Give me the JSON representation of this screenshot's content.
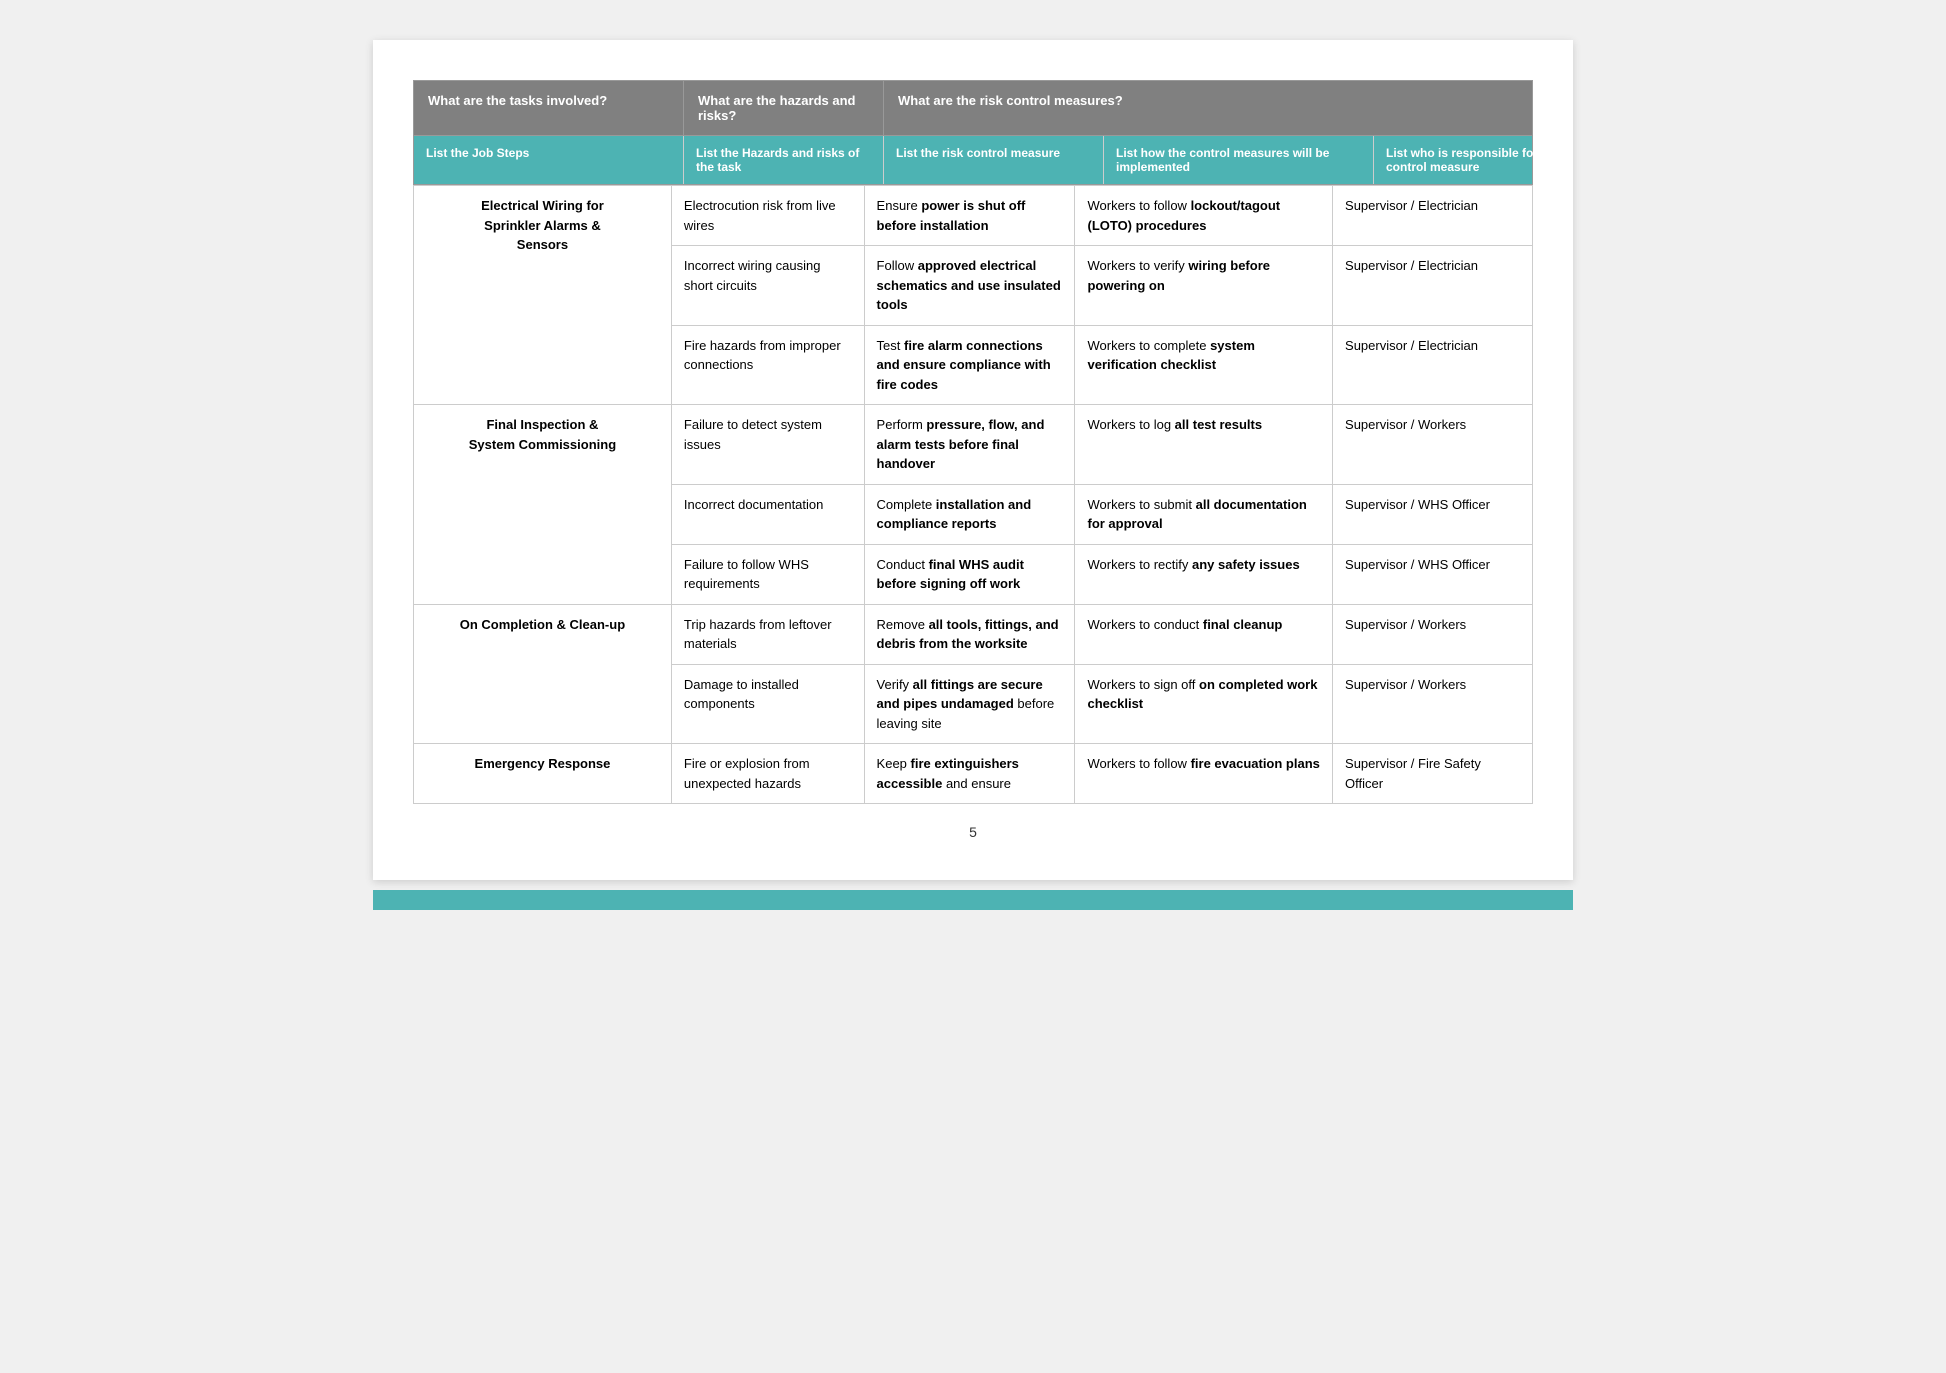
{
  "header": {
    "col1": "What are the tasks involved?",
    "col2": "What are the hazards and risks?",
    "col3": "What are the risk control measures?"
  },
  "subheader": {
    "col1": "List the Job Steps",
    "col2": "List the Hazards and risks of the task",
    "col3": "List the risk control measure",
    "col4": "List how the control measures will be implemented",
    "col5": "List who is responsible for the control measure"
  },
  "rows": [
    {
      "job_step": "Electrical Wiring for Sprinkler Alarms & Sensors",
      "hazard": "Electrocution risk from live wires",
      "control": "Ensure power is shut off before installation",
      "control_bold": [
        "power is shut",
        "off before installation"
      ],
      "implement": "Workers to follow lockout/tagout (LOTO) procedures",
      "implement_bold": [
        "lockout/tagout (LOTO)",
        "procedures"
      ],
      "responsible": "Supervisor / Electrician",
      "rowspan": 3
    },
    {
      "hazard": "Incorrect wiring causing short circuits",
      "control": "Follow approved electrical schematics and use insulated tools",
      "control_bold": [
        "approved",
        "electrical schematics",
        "and use insulated",
        "tools"
      ],
      "implement": "Workers to verify wiring before powering on",
      "implement_bold": [
        "wiring",
        "before powering on"
      ],
      "responsible": "Supervisor / Electrician"
    },
    {
      "hazard": "Fire hazards from improper connections",
      "control": "Test fire alarm connections and ensure compliance with fire codes",
      "control_bold": [
        "fire alarm",
        "connections and",
        "ensure compliance",
        "with fire codes"
      ],
      "implement": "Workers to complete system verification checklist",
      "implement_bold": [
        "system verification",
        "checklist"
      ],
      "responsible": "Supervisor / Electrician"
    },
    {
      "job_step": "Final Inspection & System Commissioning",
      "hazard": "Failure to detect system issues",
      "control": "Perform pressure, flow, and alarm tests before final handover",
      "control_bold": [
        "pressure,",
        "flow, and alarm tests",
        "before final handover"
      ],
      "implement": "Workers to log all test results",
      "implement_bold": [
        "all test",
        "results"
      ],
      "responsible": "Supervisor / Workers",
      "rowspan": 3
    },
    {
      "hazard": "Incorrect documentation",
      "control": "Complete installation and compliance reports",
      "control_bold": [
        "installation",
        "and compliance",
        "reports"
      ],
      "implement": "Workers to submit all documentation for approval",
      "implement_bold": [
        "all",
        "documentation for",
        "approval"
      ],
      "responsible": "Supervisor / WHS Officer"
    },
    {
      "hazard": "Failure to follow WHS requirements",
      "control": "Conduct final WHS audit before signing off work",
      "control_bold": [
        "final WHS",
        "audit before signing off",
        "work"
      ],
      "implement": "Workers to rectify any safety issues",
      "implement_bold": [
        "any",
        "safety issues"
      ],
      "responsible": "Supervisor / WHS Officer"
    },
    {
      "job_step": "On Completion & Clean-up",
      "hazard": "Trip hazards from leftover materials",
      "control": "Remove all tools, fittings, and debris from the worksite",
      "control_bold": [
        "all tools,",
        "fittings, and debris",
        "from the worksite"
      ],
      "implement": "Workers to conduct final cleanup",
      "implement_bold": [
        "final cleanup"
      ],
      "responsible": "Supervisor / Workers",
      "rowspan": 2
    },
    {
      "hazard": "Damage to installed components",
      "control": "Verify all fittings are secure and pipes undamaged before leaving site",
      "control_bold": [
        "all fittings are",
        "secure and pipes",
        "undamaged"
      ],
      "implement": "Workers to sign off on completed work checklist",
      "implement_bold": [
        "on",
        "completed work",
        "checklist"
      ],
      "responsible": "Supervisor / Workers"
    },
    {
      "job_step": "Emergency Response",
      "hazard": "Fire or explosion from unexpected hazards",
      "control": "Keep fire extinguishers accessible and ensure",
      "control_bold": [
        "fire extinguishers",
        "accessible"
      ],
      "implement": "Workers to follow fire evacuation plans",
      "implement_bold": [
        "fire",
        "evacuation plans"
      ],
      "responsible": "Supervisor / Fire Safety Officer",
      "rowspan": 1
    }
  ],
  "page_number": "5"
}
